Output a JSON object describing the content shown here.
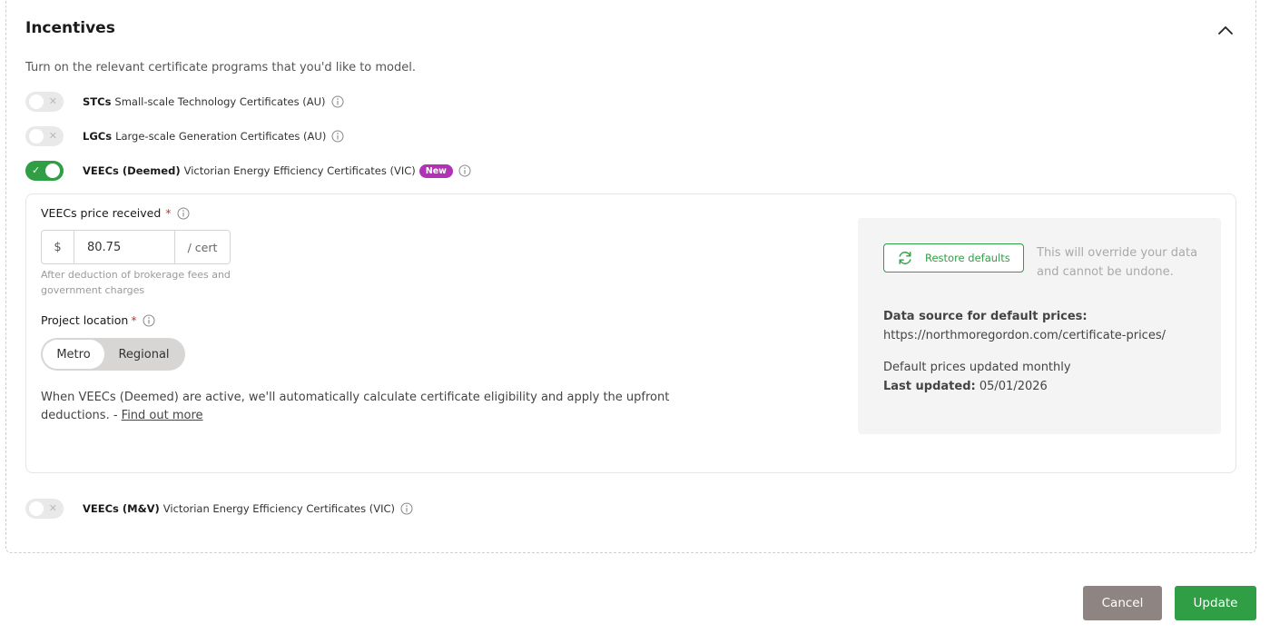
{
  "incentives": {
    "title": "Incentives",
    "intro": "Turn on the relevant certificate programs that you'd like to model.",
    "programs": [
      {
        "code": "STCs",
        "name": "Small-scale Technology Certificates (AU)",
        "enabled": false,
        "icon": "info-icon"
      },
      {
        "code": "LGCs",
        "name": "Large-scale Generation Certificates (AU)",
        "enabled": false,
        "icon": "info-icon"
      },
      {
        "code": "VEECs (Deemed)",
        "name": "Victorian Energy Efficiency Certificates (VIC)",
        "enabled": true,
        "badge": "New",
        "icon": "info-icon"
      },
      {
        "code": "VEECs (M&V)",
        "name": "Victorian Energy Efficiency Certificates (VIC)",
        "enabled": false,
        "icon": "info-icon"
      }
    ]
  },
  "veecs": {
    "price_label": "VEECs price received",
    "required_mark": "*",
    "currency_prefix": "$",
    "price_value": "80.75",
    "unit_suffix": "/ cert",
    "price_help": "After deduction of brokerage fees and government charges",
    "location_label": "Project location",
    "location_options": [
      "Metro",
      "Regional"
    ],
    "location_selected": "Metro",
    "note_text": "When VEECs (Deemed) are active, we'll automatically calculate certificate eligibility and apply the upfront deductions. - ",
    "note_link": "Find out more"
  },
  "defaults": {
    "restore_label": "Restore defaults",
    "restore_warning": "This will override your data and cannot be undone.",
    "source_label": "Data source for default prices:",
    "source_url": "https://northmoregordon.com/certificate-prices/",
    "update_frequency": "Default prices updated monthly",
    "last_updated_label": "Last updated:",
    "last_updated_value": "05/01/2026"
  },
  "footer": {
    "cancel_label": "Cancel",
    "update_label": "Update"
  },
  "colors": {
    "accent_green": "#2f9e44",
    "badge_purple": "#b232b5",
    "cancel_grey": "#8e8582",
    "required_red": "#d93025"
  }
}
